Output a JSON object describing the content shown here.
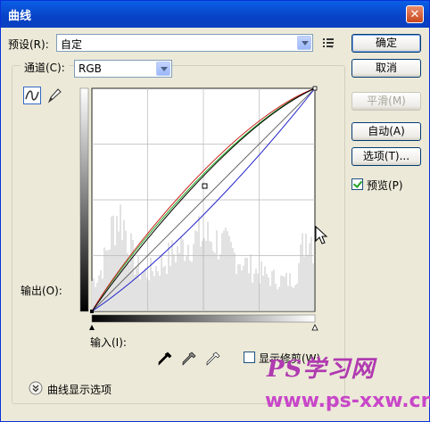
{
  "window": {
    "title": "曲线",
    "close_glyph": "✕"
  },
  "preset": {
    "label": "预设(R):",
    "value": "自定"
  },
  "channel": {
    "label": "通道(C):",
    "value": "RGB"
  },
  "buttons": {
    "ok": "确定",
    "cancel": "取消",
    "smooth": "平滑(M)",
    "auto": "自动(A)",
    "options": "选项(T)..."
  },
  "preview": {
    "label": "预览(P)",
    "checked": true
  },
  "graph": {
    "output_label": "输出(O):",
    "input_label": "输入(I):",
    "curve_point": {
      "input": 128,
      "output": 145
    }
  },
  "show_clipping": {
    "label": "显示修剪(W)",
    "checked": false
  },
  "curve_display_options": {
    "label": "曲线显示选项"
  },
  "watermark": {
    "line1": "PS学习网",
    "line2": "www.ps-xxw.cn"
  },
  "icons": {
    "curve_tool": "curve-tool-icon",
    "pencil_tool": "pencil-icon",
    "preset_menu": "preset-menu-icon",
    "black_eyedropper": "eyedropper-black-icon",
    "gray_eyedropper": "eyedropper-gray-icon",
    "white_eyedropper": "eyedropper-white-icon",
    "expand": "expand-chevron-icon",
    "cursor": "mouse-cursor-icon"
  }
}
